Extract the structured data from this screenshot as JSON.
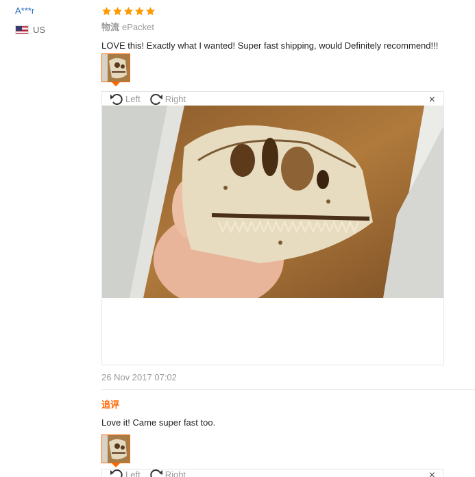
{
  "reviewer": {
    "name": "A***r",
    "country": "US",
    "flag": "us-flag"
  },
  "review": {
    "rating": 5,
    "stars": [
      "star",
      "star",
      "star",
      "star",
      "star"
    ],
    "star_color": "#ff9a00",
    "logistics_label": "物流",
    "logistics_value": "ePacket",
    "text": "LOVE this! Exactly what I wanted! Super fast shipping, would Definitely recommend!!!",
    "date": "26 Nov 2017 07:02"
  },
  "viewer": {
    "rotate_left_label": "Left",
    "rotate_right_label": "Right",
    "close_label": "×",
    "image_subject": "dinosaur-skull-photo"
  },
  "followup": {
    "label": "追评",
    "text": "Love it! Came super fast too."
  },
  "viewer2": {
    "rotate_left_label": "Left",
    "rotate_right_label": "Right",
    "close_label": "×"
  },
  "colors": {
    "accent": "#ff6600",
    "link": "#2a6ebb",
    "muted": "#999999"
  }
}
